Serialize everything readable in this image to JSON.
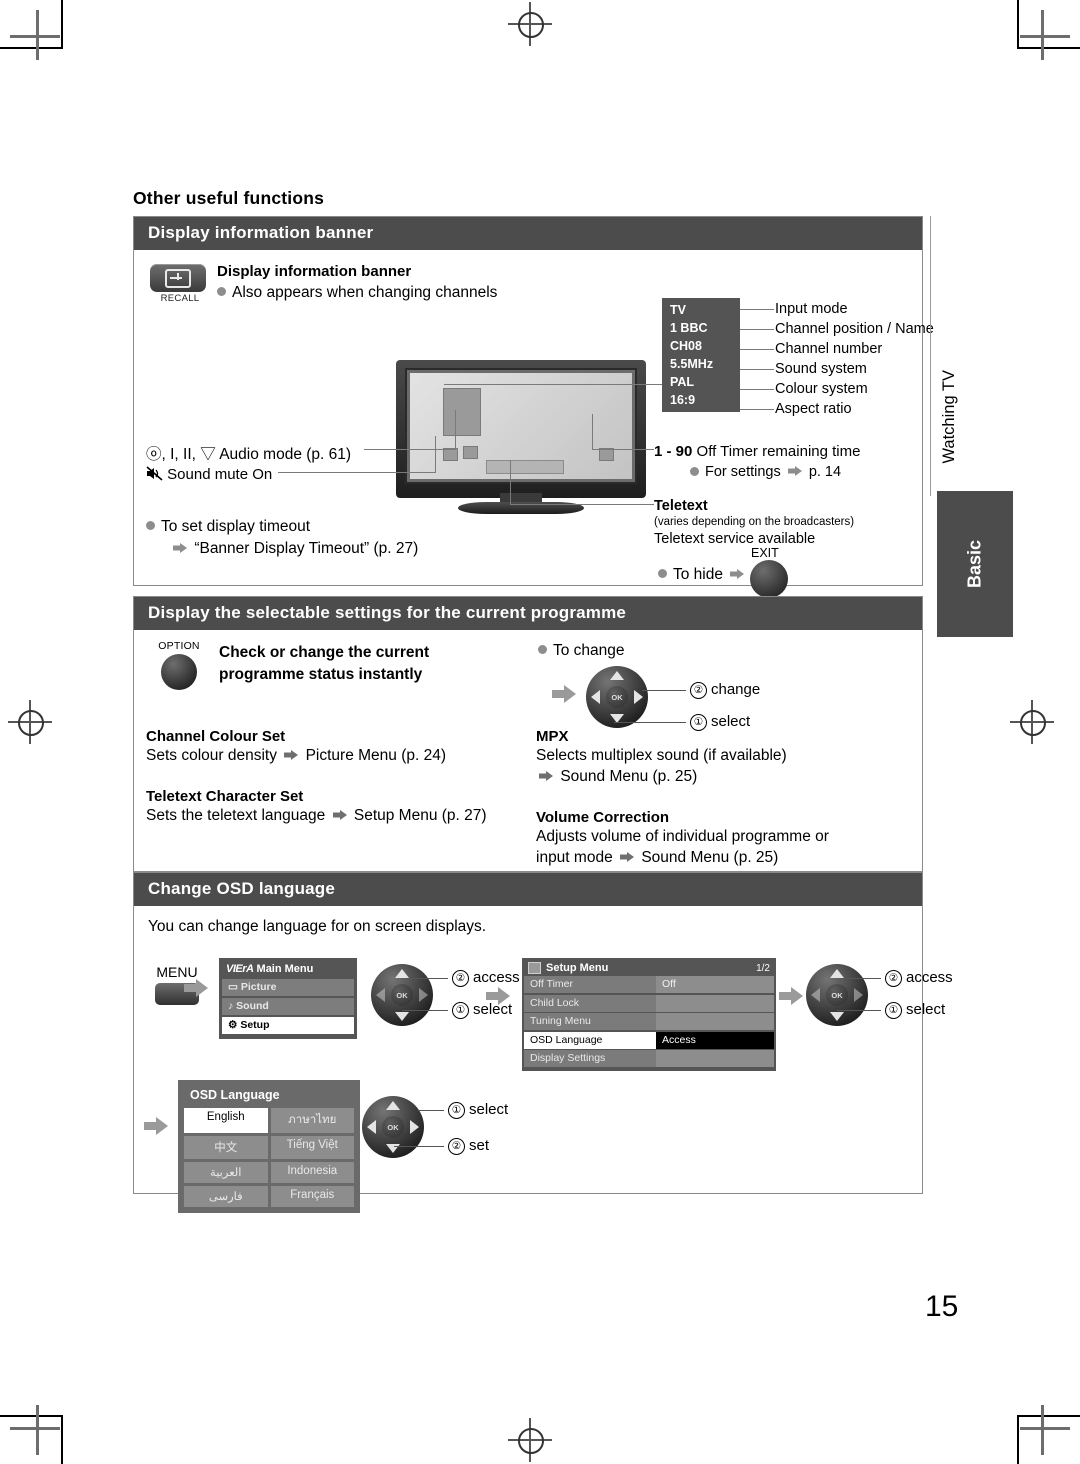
{
  "page": {
    "number": "15"
  },
  "section_title": "Other useful functions",
  "side_tabs": {
    "chapter": "Watching TV",
    "group": "Basic"
  },
  "panel1": {
    "bar_title": "Display information banner",
    "button": {
      "label": "RECALL",
      "icon": "recall-plus-icon"
    },
    "heading": "Display information banner",
    "bullet": "Also appears when changing channels",
    "audio_mode_symbols": "ⓞ, I, II, ▽",
    "audio_mode_label": "Audio mode (p. 61)",
    "mute_label": "Sound mute On",
    "timeout_bullet": "To set display timeout",
    "timeout_ref": "“Banner Display Timeout” (p. 27)",
    "osd_items": [
      {
        "value": "TV",
        "label": "Input mode"
      },
      {
        "value": "1 BBC",
        "label": "Channel position / Name"
      },
      {
        "value": "CH08",
        "label": "Channel number"
      },
      {
        "value": "5.5MHz",
        "label": "Sound system"
      },
      {
        "value": "PAL",
        "label": "Colour system"
      },
      {
        "value": "16:9",
        "label": "Aspect ratio"
      }
    ],
    "off_timer_range": "1 - 90",
    "off_timer_label": "Off Timer remaining time",
    "off_timer_settings": "For settings",
    "off_timer_page": "p. 14",
    "teletext_title": "Teletext",
    "teletext_note": "(varies depending on the broadcasters)",
    "teletext_avail": "Teletext service available",
    "to_hide": "To hide",
    "exit_label": "EXIT"
  },
  "panel2": {
    "bar_title": "Display the selectable settings for the current programme",
    "button_label": "OPTION",
    "heading_line1": "Check or change the current",
    "heading_line2": "programme status instantly",
    "to_change": "To change",
    "nav_steps": [
      {
        "num": "②",
        "label": "change"
      },
      {
        "num": "①",
        "label": "select"
      }
    ],
    "items_left": [
      {
        "title": "Channel Colour Set",
        "body_pre": "Sets colour density",
        "body_post": "Picture Menu (p. 24)"
      },
      {
        "title": "Teletext Character Set",
        "body_pre": "Sets the teletext language",
        "body_post": "Setup Menu (p. 27)"
      }
    ],
    "items_right": [
      {
        "title": "MPX",
        "body_pre": "Selects multiplex sound (if available)",
        "body_post": "Sound Menu (p. 25)"
      },
      {
        "title": "Volume Correction",
        "body_pre": "Adjusts volume of individual programme or",
        "body_post": "input mode",
        "body_end": "Sound Menu (p. 25)"
      }
    ]
  },
  "panel3": {
    "bar_title": "Change OSD language",
    "intro": "You can change language for on screen displays.",
    "menu_button": "MENU",
    "main_menu": {
      "brand": "VIErA",
      "title": "Main Menu",
      "rows": [
        {
          "label": "Picture",
          "icon": "picture-icon",
          "selected": false
        },
        {
          "label": "Sound",
          "icon": "sound-icon",
          "selected": false
        },
        {
          "label": "Setup",
          "icon": "setup-icon",
          "selected": true
        }
      ]
    },
    "nav1": [
      {
        "num": "②",
        "label": "access"
      },
      {
        "num": "①",
        "label": "select"
      }
    ],
    "setup_menu": {
      "title": "Setup Menu",
      "page": "1/2",
      "rows": [
        {
          "name": "Off Timer",
          "value": "Off",
          "selected": false
        },
        {
          "name": "Child Lock",
          "value": "",
          "selected": false
        },
        {
          "name": "Tuning Menu",
          "value": "",
          "selected": false
        },
        {
          "name": "OSD Language",
          "value": "Access",
          "selected": true
        },
        {
          "name": "Display Settings",
          "value": "",
          "selected": false
        }
      ]
    },
    "nav2": [
      {
        "num": "②",
        "label": "access"
      },
      {
        "num": "①",
        "label": "select"
      }
    ],
    "osd_language": {
      "title": "OSD Language",
      "cells": [
        {
          "label": "English",
          "selected": true
        },
        {
          "label": "ภาษาไทย",
          "selected": false
        },
        {
          "label": "中文",
          "selected": false
        },
        {
          "label": "Tiếng Việt",
          "selected": false
        },
        {
          "label": "العربية",
          "selected": false
        },
        {
          "label": "Indonesia",
          "selected": false
        },
        {
          "label": "فارسی",
          "selected": false
        },
        {
          "label": "Français",
          "selected": false
        }
      ]
    },
    "nav3": [
      {
        "num": "①",
        "label": "select"
      },
      {
        "num": "②",
        "label": "set"
      }
    ]
  }
}
